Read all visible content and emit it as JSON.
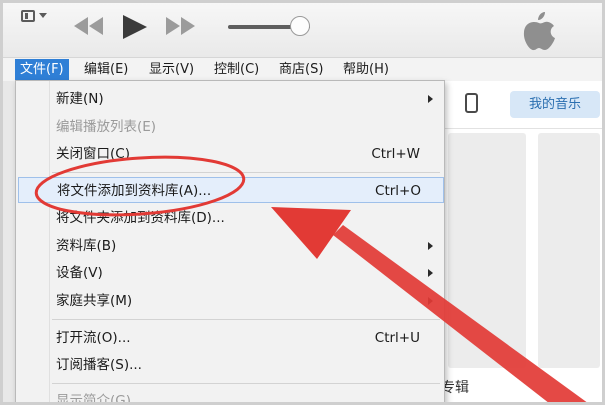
{
  "menubar": {
    "items": [
      {
        "label": "文件(F)",
        "active": true
      },
      {
        "label": "编辑(E)"
      },
      {
        "label": "显示(V)"
      },
      {
        "label": "控制(C)"
      },
      {
        "label": "商店(S)"
      },
      {
        "label": "帮助(H)"
      }
    ]
  },
  "header": {
    "my_music_label": "我的音乐"
  },
  "background": {
    "album_label": "专辑"
  },
  "file_menu": {
    "items": [
      {
        "label": "新建(N)",
        "shortcut": "",
        "submenu": true,
        "disabled": false
      },
      {
        "label": "编辑播放列表(E)",
        "shortcut": "",
        "submenu": false,
        "disabled": true
      },
      {
        "label": "关闭窗口(C)",
        "shortcut": "Ctrl+W",
        "submenu": false,
        "disabled": false
      },
      {
        "label": "将文件添加到资料库(A)...",
        "shortcut": "Ctrl+O",
        "submenu": false,
        "disabled": false,
        "highlighted": true
      },
      {
        "label": "将文件夹添加到资料库(D)...",
        "shortcut": "",
        "submenu": false,
        "disabled": false
      },
      {
        "label": "资料库(B)",
        "shortcut": "",
        "submenu": true,
        "disabled": false
      },
      {
        "label": "设备(V)",
        "shortcut": "",
        "submenu": true,
        "disabled": false
      },
      {
        "label": "家庭共享(M)",
        "shortcut": "",
        "submenu": true,
        "disabled": false
      },
      {
        "label": "打开流(O)...",
        "shortcut": "Ctrl+U",
        "submenu": false,
        "disabled": false
      },
      {
        "label": "订阅播客(S)...",
        "shortcut": "",
        "submenu": false,
        "disabled": false
      },
      {
        "label": "显示简介(G)",
        "shortcut": "",
        "submenu": false,
        "disabled": true
      }
    ]
  },
  "colors": {
    "menubar_active": "#2f7fd6",
    "highlight_bg": "#e4eefb",
    "annotation_red": "#e23a35"
  },
  "icons": [
    "menu-icon",
    "previous-icon",
    "play-icon",
    "next-icon",
    "volume-slider",
    "apple-logo-icon",
    "device-icon",
    "submenu-arrow-icon"
  ]
}
